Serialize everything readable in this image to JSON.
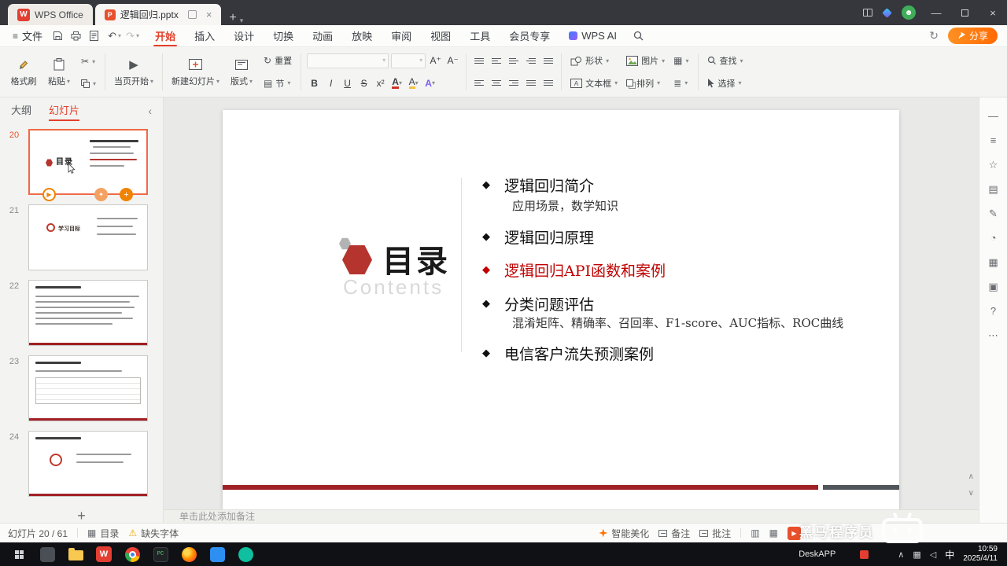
{
  "colors": {
    "accent": "#e3402a",
    "share_orange": "#ff6a00",
    "slide_red": "#c00000",
    "footer_bar_red": "#a02125",
    "footer_bar_dark": "#50565a",
    "selected_thumb_border": "#ef6a45",
    "wps_red": "#e23f32"
  },
  "titlebar": {
    "app_tab": "WPS Office",
    "doc_tab": "逻辑回归.pptx"
  },
  "menubar": {
    "file": "文件",
    "tabs": [
      {
        "label": "开始"
      },
      {
        "label": "插入"
      },
      {
        "label": "设计"
      },
      {
        "label": "切换"
      },
      {
        "label": "动画"
      },
      {
        "label": "放映"
      },
      {
        "label": "审阅"
      },
      {
        "label": "视图"
      },
      {
        "label": "工具"
      },
      {
        "label": "会员专享"
      },
      {
        "label": "WPS AI"
      }
    ],
    "share": "分享"
  },
  "toolbar": {
    "format_painter": "格式刷",
    "paste": "粘贴",
    "play_current": "当页开始",
    "new_slide": "新建幻灯片",
    "layout": "版式",
    "reset": "重置",
    "section": "节",
    "bold": "B",
    "italic": "I",
    "underline": "U",
    "strike": "S",
    "shapes": "形状",
    "textbox": "文本框",
    "picture": "图片",
    "arrange": "排列",
    "find": "查找",
    "select": "选择"
  },
  "sidebar": {
    "outline_tab": "大纲",
    "slides_tab": "幻灯片",
    "slide_numbers": [
      "20",
      "21",
      "22",
      "23",
      "24"
    ],
    "thumb_20_title": "目录",
    "thumb_21_title": "学习目标"
  },
  "slide": {
    "title": "目录",
    "subtitle": "Contents",
    "items": [
      {
        "text": "逻辑回归简介",
        "sub": "应用场景，数学知识"
      },
      {
        "text": "逻辑回归原理"
      },
      {
        "text": "逻辑回归API函数和案例"
      },
      {
        "text": "分类问题评估",
        "sub": "混淆矩阵、精确率、召回率、F1-score、AUC指标、ROC曲线"
      },
      {
        "text": "电信客户流失预测案例"
      }
    ]
  },
  "notes": {
    "placeholder": "单击此处添加备注"
  },
  "statusbar": {
    "slide_counter": "幻灯片 20 / 61",
    "section_name": "目录",
    "missing_fonts": "缺失字体",
    "beautify": "智能美化",
    "notes_btn": "备注",
    "comments_btn": "批注"
  },
  "taskbar": {
    "deskapp": "DeskAPP",
    "ime": "中",
    "time": "10:59",
    "date": "2025/4/11"
  },
  "watermark": {
    "text": "黑马程序员"
  }
}
